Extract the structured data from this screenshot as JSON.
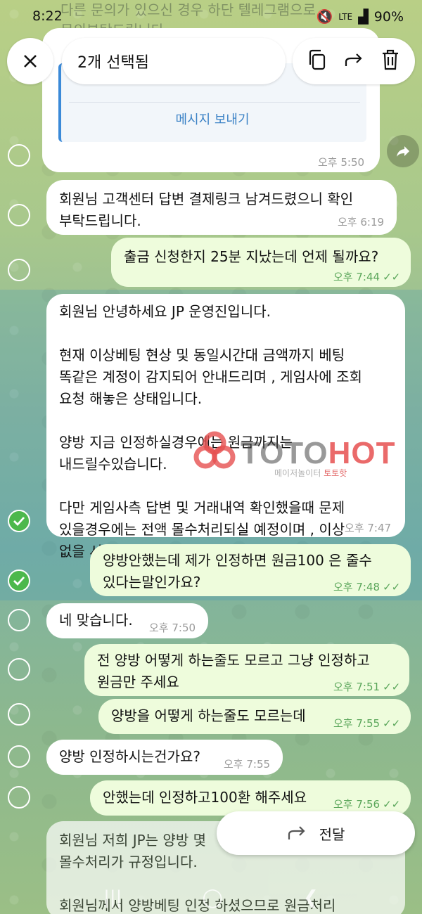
{
  "status": {
    "time": "8:22",
    "network": "LTE",
    "battery": "90%"
  },
  "header": {
    "selection_label": "2개 선택됨"
  },
  "behind_text": "다른 문의가 있으신 경우 하단 텔레그램으로\n문의부탁드립니다.",
  "card": {
    "link_label": "메시지 보내기",
    "time": "오후 5:50"
  },
  "messages": [
    {
      "text": "회원님 고객센터 답변 결제링크 남겨드렸으니 확인\n부탁드립니다.",
      "time": "오후 6:19"
    },
    {
      "text": "출금 신청한지 25분 지났는데 언제 될까요?",
      "time": "오후 7:44"
    },
    {
      "text": "회원님 안녕하세요 JP 운영진입니다.\n\n현재 이상베팅 현상 및 동일시간대 금액까지 베팅\n똑같은 계정이 감지되어 안내드리며 , 게임사에 조회\n요청 해놓은 상태입니다.\n\n양방 지금 인정하실경우에는 원금까지는\n내드릴수있습니다.\n\n다만 게임사측 답변 및 거래내역 확인했을때 문제\n있을경우에는 전액 몰수처리되실 예정이며 , 이상\n없을 시 전액 환전 되실예정입니다.",
      "time": "오후 7:47"
    },
    {
      "text": "양방안했는데 제가 인정하면 원금100 은 줄수\n있다는말인가요?",
      "time": "오후 7:48"
    },
    {
      "text": "네 맞습니다.",
      "time": "오후 7:50"
    },
    {
      "text": "전 양방 어떻게 하는줄도 모르고 그냥 인정하고\n원금만 주세요",
      "time": "오후 7:51"
    },
    {
      "text": "양방을 어떻게 하는줄도 모르는데",
      "time": "오후 7:55"
    },
    {
      "text": "양방 인정하시는건가요?",
      "time": "오후 7:55"
    },
    {
      "text": "안했는데 인정하고100환 해주세요",
      "time": "오후 7:56"
    },
    {
      "text": "회원님 저희 JP는 양방 몇\n몰수처리가 규정입니다.\n\n회원님께서 양방베팅 인정 하셨으므로 원금처리\n않으시면 전액 몰수처리될 예정입니다. 인정 참고"
    }
  ],
  "watermark": {
    "brand_a": "TOTO",
    "brand_b": "HOT",
    "sub_a": "메이저놀이터",
    "sub_b": "토토핫"
  },
  "forward_button": {
    "label": "전달"
  },
  "nav": {
    "recent": "|||",
    "home": "◯",
    "back": "❮"
  }
}
